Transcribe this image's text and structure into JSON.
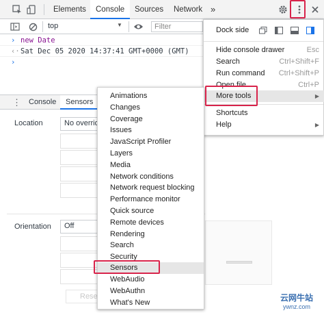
{
  "toolbar": {
    "tabs": [
      "Elements",
      "Console",
      "Sources",
      "Network"
    ],
    "active_tab": "Console",
    "more_tabs_glyph": "»"
  },
  "filterbar": {
    "context": "top",
    "filter_placeholder": "Filter"
  },
  "console": {
    "input_command": "new Date",
    "output": "Sat Dec 05 2020 14:37:41 GMT+0000 (GMT)"
  },
  "drawer": {
    "tabs": [
      "Console",
      "Sensors"
    ],
    "active_tab": "Sensors",
    "location_label": "Location",
    "location_value": "No override",
    "orientation_label": "Orientation",
    "orientation_value": "Off",
    "reset_label": "Reset"
  },
  "main_menu": {
    "dock_side_label": "Dock side",
    "items": [
      {
        "label": "Hide console drawer",
        "shortcut": "Esc"
      },
      {
        "label": "Search",
        "shortcut": "Ctrl+Shift+F"
      },
      {
        "label": "Run command",
        "shortcut": "Ctrl+Shift+P"
      },
      {
        "label": "Open file",
        "shortcut": "Ctrl+P"
      },
      {
        "label": "More tools",
        "shortcut": ""
      },
      {
        "label": "Shortcuts",
        "shortcut": ""
      },
      {
        "label": "Help",
        "shortcut": ""
      }
    ]
  },
  "more_tools_menu": {
    "items": [
      "Animations",
      "Changes",
      "Coverage",
      "Issues",
      "JavaScript Profiler",
      "Layers",
      "Media",
      "Network conditions",
      "Network request blocking",
      "Performance monitor",
      "Quick source",
      "Remote devices",
      "Rendering",
      "Search",
      "Security",
      "Sensors",
      "WebAudio",
      "WebAuthn",
      "What's New"
    ],
    "highlighted": "Sensors"
  },
  "watermark": {
    "cn": "云网牛站",
    "site": "ywnz.com"
  },
  "colors": {
    "accent": "#1a73e8",
    "highlight_box": "#d8234a",
    "prompt": "#1a73e8"
  }
}
